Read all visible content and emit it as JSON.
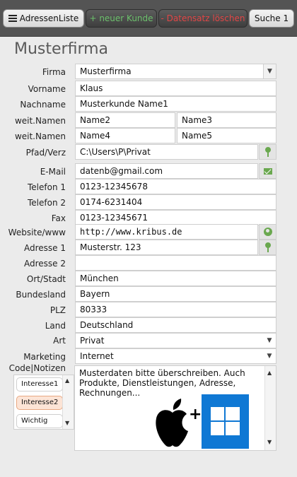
{
  "toolbar": {
    "list_label": "AdressenListe",
    "new_label": "+ neuer Kunde",
    "delete_label": "- Datensatz löschen",
    "search_label": "Suche 1"
  },
  "company_title": "Musterfirma",
  "labels": {
    "firma": "Firma",
    "vorname": "Vorname",
    "nachname": "Nachname",
    "weit_namen_1": "weit.Namen",
    "weit_namen_2": "weit.Namen",
    "pfad": "Pfad/Verz",
    "email": "E-Mail",
    "telefon1": "Telefon 1",
    "telefon2": "Telefon 2",
    "fax": "Fax",
    "website": "Website/www",
    "adresse1": "Adresse 1",
    "adresse2": "Adresse 2",
    "ort": "Ort/Stadt",
    "bundesland": "Bundesland",
    "plz": "PLZ",
    "land": "Land",
    "art": "Art",
    "marketing": "Marketing",
    "code_notizen": "Code|Notizen"
  },
  "values": {
    "firma": "Musterfirma",
    "vorname": "Klaus",
    "nachname": "Musterkunde Name1",
    "name2": "Name2",
    "name3": "Name3",
    "name4": "Name4",
    "name5": "Name5",
    "pfad": "C:\\Users\\P\\Privat",
    "email": "datenb@gmail.com",
    "telefon1": "0123-12345678",
    "telefon2": "0174-6231404",
    "fax": "0123-12345671",
    "website": "http://www.kribus.de",
    "adresse1": "Musterstr. 123",
    "adresse2": "",
    "ort": "München",
    "bundesland": "Bayern",
    "plz": "80333",
    "land": "Deutschland",
    "art": "Privat",
    "marketing": "Internet"
  },
  "codes": [
    "Interesse1",
    "Interesse2",
    "Wichtig"
  ],
  "notes": "Musterdaten bitte überschreiben. Auch Produkte, Dienstleistungen, Adresse, Rechnungen...",
  "logo_plus": "+",
  "colors": {
    "toolbar_bg": "#545454",
    "new_text": "#6cc06c",
    "delete_text": "#e04646",
    "icon_green": "#6aa84f",
    "windows_blue": "#0f78d4",
    "active_code_bg": "#fce4d6"
  },
  "icons": {
    "list": "list-icon",
    "pin": "map-pin-icon",
    "mail": "mail-icon",
    "globe": "globe-icon",
    "apple": "apple-logo",
    "windows": "windows-logo"
  }
}
